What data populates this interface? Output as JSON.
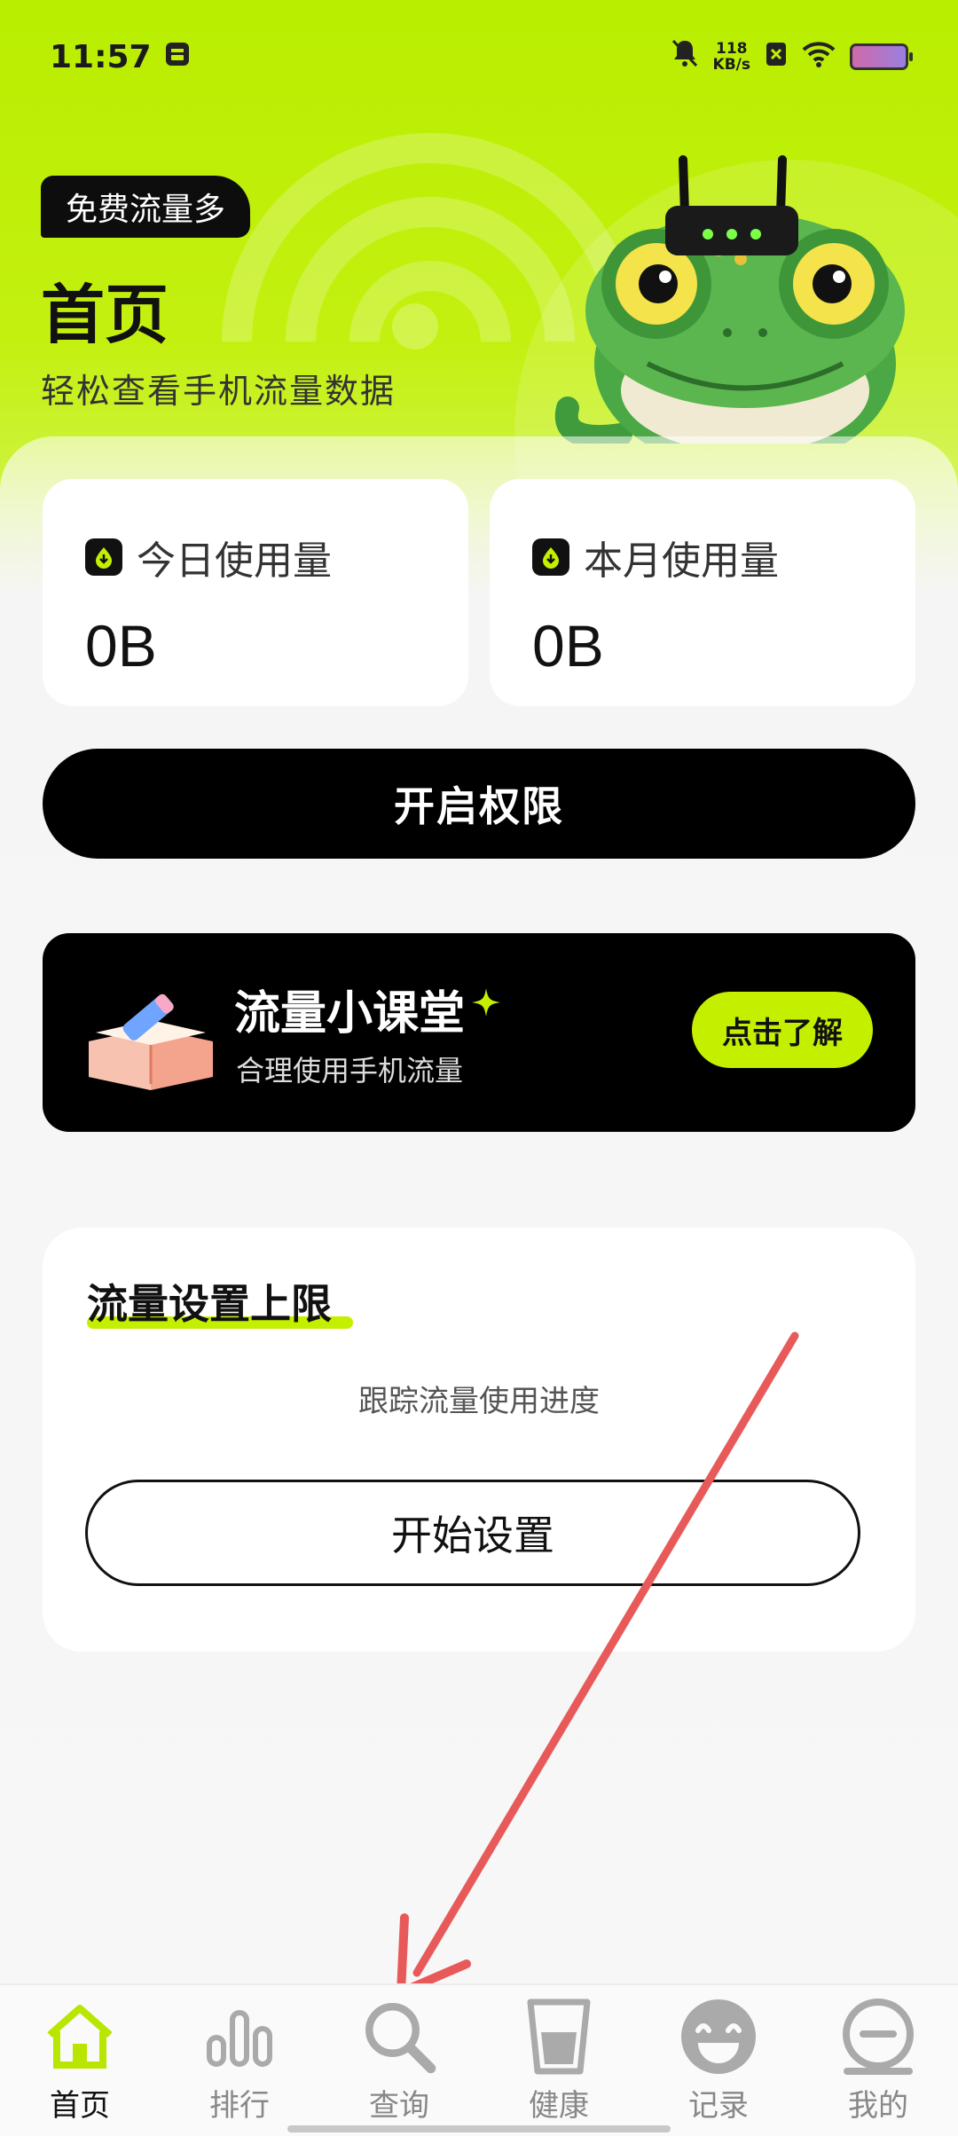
{
  "status_bar": {
    "time": "11:57",
    "net_speed_value": "118",
    "net_speed_unit": "KB/s"
  },
  "header": {
    "tag": "免费流量多",
    "title": "首页",
    "subtitle": "轻松查看手机流量数据"
  },
  "stats": [
    {
      "label": "今日使用量",
      "value": "0B"
    },
    {
      "label": "本月使用量",
      "value": "0B"
    }
  ],
  "permission_button": "开启权限",
  "classroom": {
    "title": "流量小课堂",
    "description": "合理使用手机流量",
    "button": "点击了解"
  },
  "limit_card": {
    "title": "流量设置上限",
    "hint": "跟踪流量使用进度",
    "button": "开始设置"
  },
  "nav": {
    "items": [
      {
        "label": "首页",
        "icon": "home-icon",
        "active": true
      },
      {
        "label": "排行",
        "icon": "rank-icon",
        "active": false
      },
      {
        "label": "查询",
        "icon": "search-icon",
        "active": false
      },
      {
        "label": "健康",
        "icon": "cup-icon",
        "active": false
      },
      {
        "label": "记录",
        "icon": "smile-icon",
        "active": false
      },
      {
        "label": "我的",
        "icon": "profile-icon",
        "active": false
      }
    ]
  },
  "colors": {
    "accent": "#c4f000",
    "dark": "#000000",
    "annotation_arrow": "#e85a5a"
  }
}
